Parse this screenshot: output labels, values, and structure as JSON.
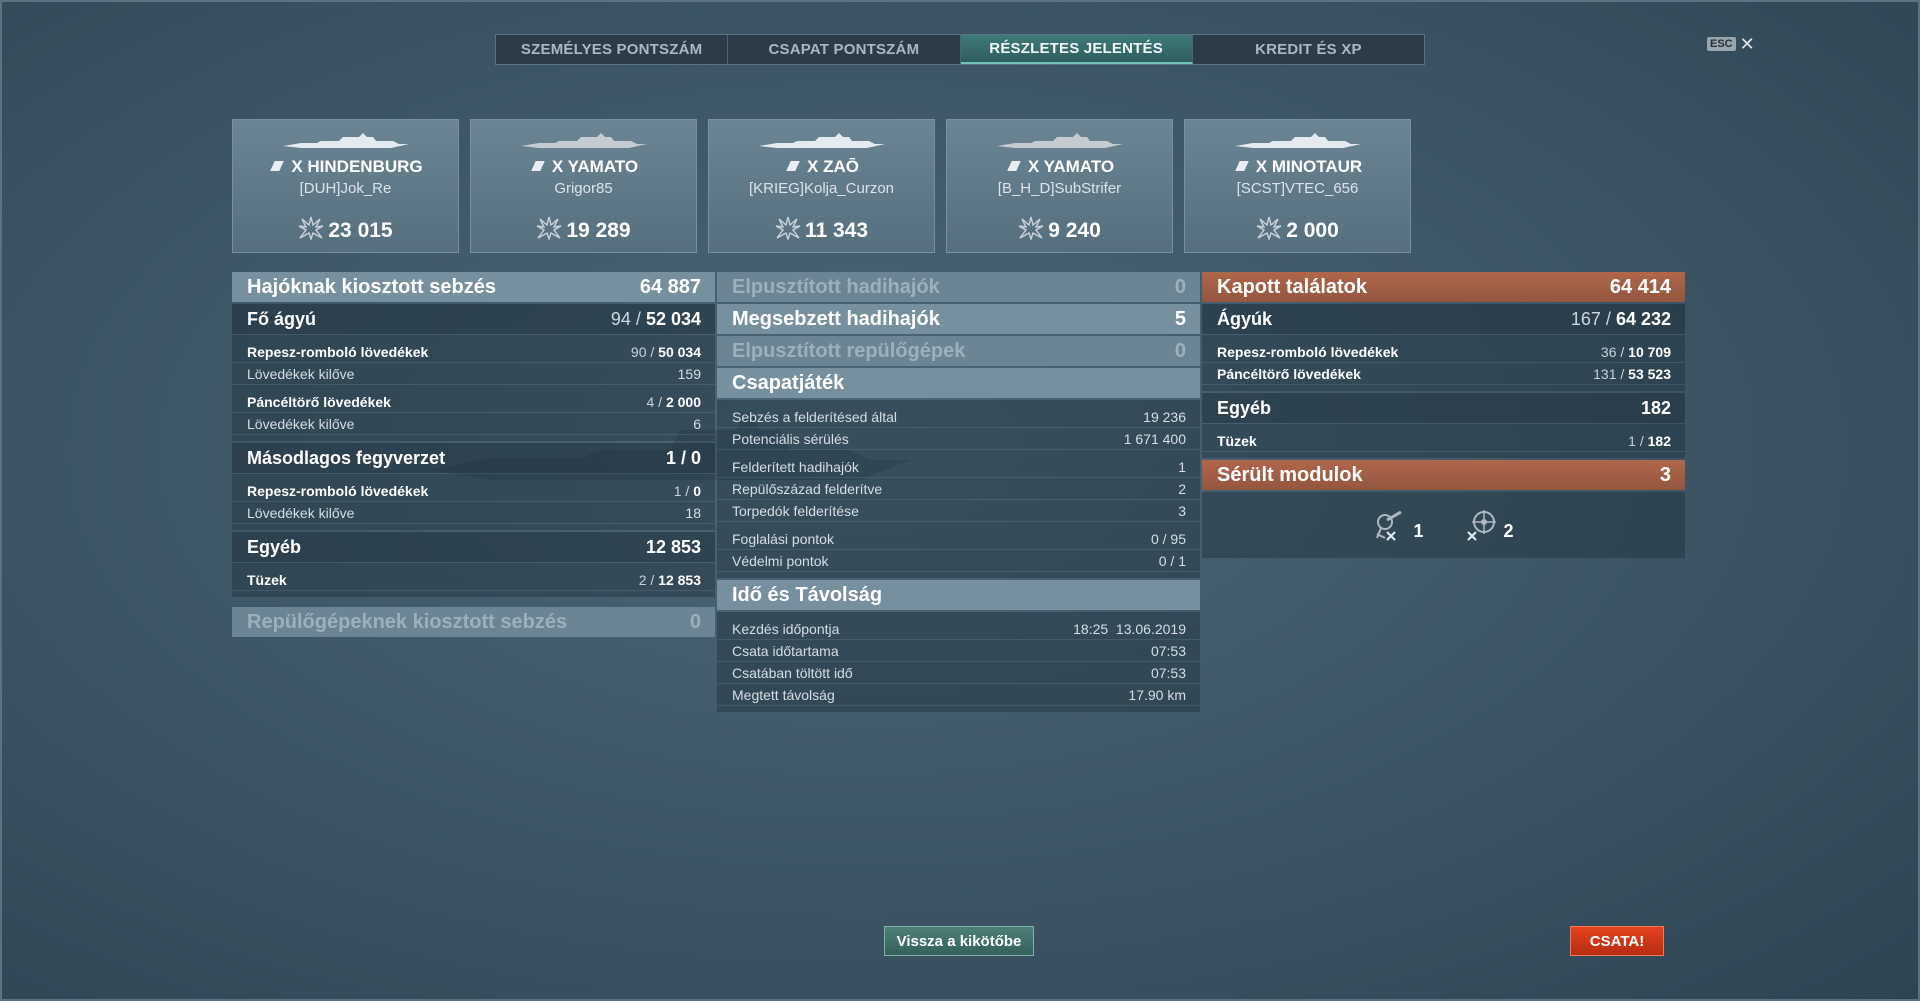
{
  "tabs": [
    {
      "label": "SZEMÉLYES PONTSZÁM"
    },
    {
      "label": "CSAPAT PONTSZÁM"
    },
    {
      "label": "RÉSZLETES JELENTÉS"
    },
    {
      "label": "KREDIT ÉS XP"
    }
  ],
  "close": {
    "esc": "ESC",
    "x": "✕"
  },
  "ships": [
    {
      "name": "X HINDENBURG",
      "player": "[DUH]Jok_Re",
      "damage": "23 015"
    },
    {
      "name": "X YAMATO",
      "player": "Grigor85",
      "damage": "19 289"
    },
    {
      "name": "X ZAŌ",
      "player": "[KRIEG]Kolja_Curzon",
      "damage": "11 343"
    },
    {
      "name": "X YAMATO",
      "player": "[B_H_D]SubStrifer",
      "damage": "9 240"
    },
    {
      "name": "X MINOTAUR",
      "player": "[SCST]VTEC_656",
      "damage": "2 000"
    }
  ],
  "left": {
    "header": {
      "label": "Hajóknak kiosztott sebzés",
      "value": "64 887"
    },
    "main_guns": {
      "label": "Fő ágyú",
      "a": "94",
      "sep": " / ",
      "b": "52 034"
    },
    "he1": {
      "label": "Repesz-romboló lövedékek",
      "a": "90",
      "sep": " / ",
      "b": "50 034"
    },
    "fired1": {
      "label": "Lövedékek kilőve",
      "value": "159"
    },
    "ap": {
      "label": "Páncéltörő lövedékek",
      "a": "4",
      "sep": " / ",
      "b": "2 000"
    },
    "fired2": {
      "label": "Lövedékek kilőve",
      "value": "6"
    },
    "secondary": {
      "label": "Másodlagos fegyverzet",
      "value": "1 / 0"
    },
    "he2": {
      "label": "Repesz-romboló lövedékek",
      "a": "1",
      "sep": " / ",
      "b": "0"
    },
    "fired3": {
      "label": "Lövedékek kilőve",
      "value": "18"
    },
    "other": {
      "label": "Egyéb",
      "value": "12 853"
    },
    "fires": {
      "label": "Tüzek",
      "a": "2",
      "sep": " / ",
      "b": "12 853"
    },
    "aircraft": {
      "label": "Repülőgépeknek kiosztott sebzés",
      "value": "0"
    }
  },
  "middle": {
    "destroyed": {
      "label": "Elpusztított hadihajók",
      "value": "0"
    },
    "damaged": {
      "label": "Megsebzett hadihajók",
      "value": "5"
    },
    "planes": {
      "label": "Elpusztított repülőgépek",
      "value": "0"
    },
    "team": {
      "label": "Csapatjáték"
    },
    "spot_dmg": {
      "label": "Sebzés a felderítésed által",
      "value": "19 236"
    },
    "potential": {
      "label": "Potenciális sérülés",
      "value": "1 671 400"
    },
    "spotted": {
      "label": "Felderített hadihajók",
      "value": "1"
    },
    "squadrons": {
      "label": "Repülőszázad felderítve",
      "value": "2"
    },
    "torps": {
      "label": "Torpedók felderítése",
      "value": "3"
    },
    "capture": {
      "label": "Foglalási pontok",
      "value": "0 / 95"
    },
    "defense": {
      "label": "Védelmi pontok",
      "value": "0 / 1"
    },
    "time": {
      "label": "Idő és Távolság"
    },
    "start": {
      "label": "Kezdés időpontja",
      "value": "18:25  13.06.2019"
    },
    "duration": {
      "label": "Csata időtartama",
      "value": "07:53"
    },
    "in_battle": {
      "label": "Csatában töltött idő",
      "value": "07:53"
    },
    "distance": {
      "label": "Megtett távolság",
      "value": "17.90 km"
    }
  },
  "right": {
    "header": {
      "label": "Kapott találatok",
      "value": "64 414"
    },
    "guns": {
      "label": "Ágyúk",
      "a": "167",
      "sep": " / ",
      "b": "64 232"
    },
    "he": {
      "label": "Repesz-romboló lövedékek",
      "a": "36",
      "sep": " / ",
      "b": "10 709"
    },
    "ap": {
      "label": "Páncéltörő lövedékek",
      "a": "131",
      "sep": " / ",
      "b": "53 523"
    },
    "other": {
      "label": "Egyéb",
      "value": "182"
    },
    "fires": {
      "label": "Tüzek",
      "a": "1",
      "sep": " / ",
      "b": "182"
    },
    "modules": {
      "label": "Sérült modulok",
      "value": "3"
    },
    "mod1": {
      "count": "1"
    },
    "mod2": {
      "count": "2"
    }
  },
  "buttons": {
    "back": "Vissza a kikötőbe",
    "battle": "CSATA!"
  },
  "colors": {
    "accent_teal": "#3f7a78",
    "orange_header": "#b0664a",
    "battle_red": "#e4421e"
  }
}
